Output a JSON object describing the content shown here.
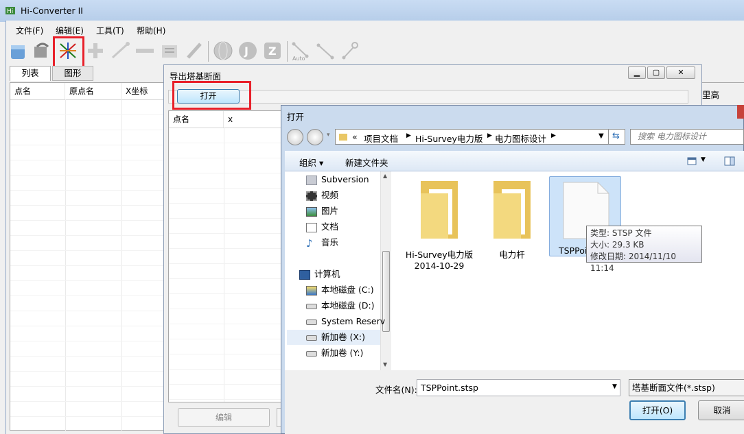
{
  "app": {
    "title": "Hi-Converter II"
  },
  "menu": [
    {
      "label": "文件(F)"
    },
    {
      "label": "编辑(E)"
    },
    {
      "label": "工具(T)"
    },
    {
      "label": "帮助(H)"
    }
  ],
  "toolbar": {
    "auto_label": "Auto"
  },
  "tabs": [
    {
      "label": "列表"
    },
    {
      "label": "图形"
    }
  ],
  "main_grid": {
    "columns": [
      "点名",
      "原点名",
      "X坐标"
    ]
  },
  "right_hint": "里高",
  "export_dialog": {
    "title": "导出塔基断面",
    "open_button": "打开",
    "grid_columns": [
      "点名",
      "x"
    ],
    "edit_button": "编辑"
  },
  "open_dialog": {
    "title": "打开",
    "address": [
      "«",
      "项目文档",
      "Hi-Survey电力版",
      "电力图标设计"
    ],
    "search_placeholder": "搜索 电力图标设计",
    "organize": "组织 ▾",
    "new_folder": "新建文件夹",
    "nav_items": [
      {
        "label": "Subversion",
        "icon": "subversion-icon"
      },
      {
        "label": "视频",
        "icon": "video-library-icon"
      },
      {
        "label": "图片",
        "icon": "pictures-library-icon"
      },
      {
        "label": "文档",
        "icon": "documents-library-icon"
      },
      {
        "label": "音乐",
        "icon": "music-library-icon"
      },
      {
        "label": "计算机",
        "icon": "computer-icon"
      },
      {
        "label": "本地磁盘 (C:)",
        "icon": "system-drive-icon"
      },
      {
        "label": "本地磁盘 (D:)",
        "icon": "drive-icon"
      },
      {
        "label": "System Reserv",
        "icon": "drive-icon"
      },
      {
        "label": "新加卷 (X:)",
        "icon": "drive-icon"
      },
      {
        "label": "新加卷 (Y:)",
        "icon": "drive-icon"
      }
    ],
    "files": [
      {
        "name": "Hi-Survey电力版",
        "name2": "2014-10-29",
        "icon": "folder-icon"
      },
      {
        "name": "电力杆",
        "name2": "",
        "icon": "folder-icon"
      },
      {
        "name": "TSPPoint",
        "name2": "",
        "icon": "file-icon"
      }
    ],
    "tooltip": {
      "type": "类型: STSP 文件",
      "size": "大小: 29.3 KB",
      "modified": "修改日期: 2014/11/10 11:14"
    },
    "filename_label": "文件名(N):",
    "filename_value": "TSPPoint.stsp",
    "filetype": "塔基断面文件(*.stsp)",
    "ok_button": "打开(O)",
    "cancel_button": "取消"
  }
}
